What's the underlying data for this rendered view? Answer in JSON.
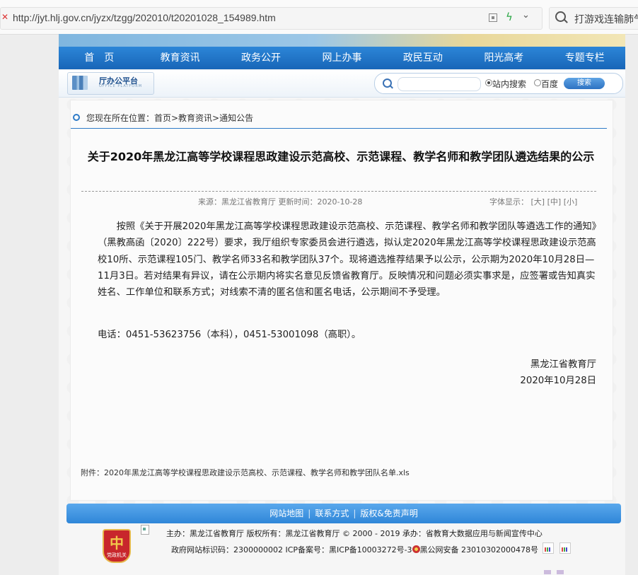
{
  "browser": {
    "url": "http://jyt.hlj.gov.cn/jyzx/tzgg/202010/t20201028_154989.htm",
    "search_text": "打游戏连输肺气",
    "icons": [
      "close-icon",
      "qr-code-icon",
      "bolt-icon",
      "chevron-down-icon",
      "search-icon"
    ]
  },
  "nav": {
    "items": [
      "首　页",
      "教育资讯",
      "政务公开",
      "网上办事",
      "政民互动",
      "阳光高考",
      "专题专栏"
    ]
  },
  "platform": {
    "title": "厅办公平台",
    "subtitle": "OFFICE PLATFORM"
  },
  "site_search": {
    "placeholder": "",
    "option_site": "站内搜索",
    "option_baidu": "百度",
    "selected": "站内搜索",
    "button": "搜索"
  },
  "breadcrumb": {
    "text": "您现在所在位置：首页>教育资讯>通知公告"
  },
  "article": {
    "title": "关于2020年黑龙江高等学校课程思政建设示范高校、示范课程、教学名师和教学团队遴选结果的公示",
    "source_label": "来源：黑龙江省教育厅  更新时间：2020-10-28",
    "font_label": "字体显示：",
    "font_large": "[大]",
    "font_medium": "[中]",
    "font_small": "[小]",
    "paragraph": "按照《关于开展2020年黑龙江高等学校课程思政建设示范高校、示范课程、教学名师和教学团队等遴选工作的通知》（黑教高函〔2020〕222号）要求，我厅组织专家委员会进行遴选，拟认定2020年黑龙江高等学校课程思政建设示范高校10所、示范课程105门、教学名师33名和教学团队37个。现将遴选推荐结果予以公示，公示期为2020年10月28日—11月3日。若对结果有异议，请在公示期内将实名意见反馈省教育厅。反映情况和问题必须实事求是，应签署或告知真实姓名、工作单位和联系方式；对线索不清的匿名信和匿名电话，公示期间不予受理。",
    "phone": "电话：0451-53623756（本科），0451-53001098（高职）。",
    "signature_org": "黑龙江省教育厅",
    "signature_date": "2020年10月28日",
    "attachment_label": "附件：",
    "attachment_link": "2020年黑龙江高等学校课程思政建设示范高校、示范课程、教学名师和教学团队名单.xls"
  },
  "footer": {
    "links": [
      "网站地图",
      "联系方式",
      "版权&免责声明"
    ],
    "line1": "主办：黑龙江省教育厅  版权所有：黑龙江省教育厅 © 2000 - 2019 承办：省教育大数据应用与新闻宣传中心",
    "line2_prefix": "政府网站标识码：2300000002 ICP备案号：黑ICP备10003272号-3",
    "line2_suffix": "黑公网安备 23010302000478号",
    "badge_text": "党政机关",
    "badge_glyph": "中"
  },
  "colors": {
    "nav_blue": "#1f72c4",
    "footer_blue": "#3b8fdc",
    "link_blue": "#2e7bc8"
  }
}
